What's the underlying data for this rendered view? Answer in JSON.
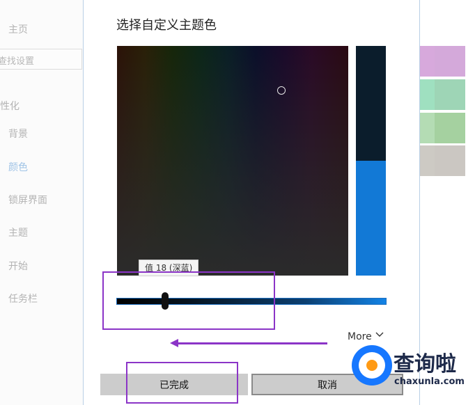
{
  "nav": {
    "home": "主页",
    "search_placeholder": "查找设置",
    "section": "性化",
    "items": [
      "背景",
      "颜色",
      "锁屏界面",
      "主题",
      "开始",
      "任务栏"
    ]
  },
  "dialog": {
    "title": "选择自定义主题色",
    "tooltip": "值 18 (深蓝)",
    "more": "More",
    "done": "已完成",
    "cancel": "取消",
    "value_fraction": 0.18
  },
  "swatch_colors": [
    "#d7a9dc",
    "#d4a9da",
    "#9fe0c0",
    "#9ed5b6",
    "#b4dcb4",
    "#a5d1a0",
    "#cdcac4",
    "#cbc7c2"
  ],
  "watermark": {
    "cn": "查询啦",
    "en": "chaxunla.com"
  },
  "colors": {
    "accent": "#1279d6",
    "annotation": "#8b34c7"
  }
}
